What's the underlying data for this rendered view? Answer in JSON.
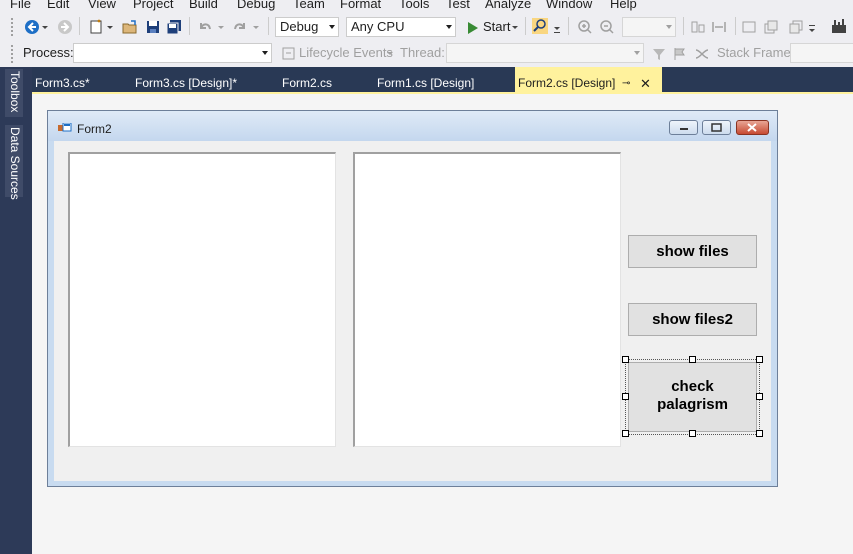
{
  "menu": [
    "File",
    "Edit",
    "View",
    "Project",
    "Build",
    "Debug",
    "Team",
    "Format",
    "Tools",
    "Test",
    "Analyze",
    "Window",
    "Help"
  ],
  "toolbar": {
    "configuration": "Debug",
    "platform": "Any CPU",
    "start_label": "Start",
    "icons": [
      "back-icon",
      "forward-icon",
      "new-project-icon",
      "open-icon",
      "save-icon",
      "save-all-icon",
      "undo-icon",
      "redo-icon",
      "start-icon",
      "find-icon",
      "zoom-in-icon",
      "zoom-out-icon"
    ]
  },
  "debug_toolbar": {
    "process_label": "Process:",
    "process_value": "",
    "lifecycle_label": "Lifecycle Events",
    "thread_label": "Thread:",
    "thread_value": "",
    "stack_frame_label": "Stack Frame:"
  },
  "side_tabs": [
    "Toolbox",
    "Data Sources"
  ],
  "tabs": [
    {
      "label": "Form3.cs*"
    },
    {
      "label": "Form3.cs [Design]*"
    },
    {
      "label": "Form2.cs"
    },
    {
      "label": "Form1.cs [Design]"
    },
    {
      "label": "Form2.cs [Design]",
      "active": true
    }
  ],
  "form": {
    "title": "Form2",
    "buttons": {
      "show_files": "show files",
      "show_files2": "show files2",
      "check_line1": "check",
      "check_line2": "palagrism"
    }
  },
  "colors": {
    "accent_tab": "#fff29d",
    "tab_bar": "#293955",
    "side_strip": "#2d3a58"
  }
}
